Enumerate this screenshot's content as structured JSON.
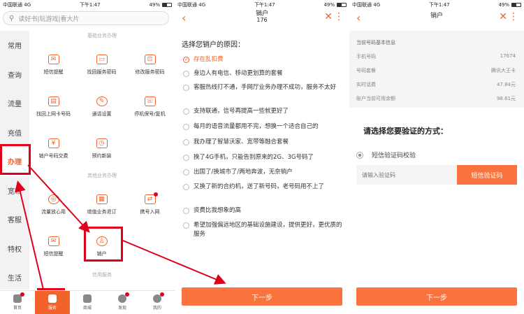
{
  "accent_color": "#f2632b",
  "highlight_color": "#e0001b",
  "status_bar": {
    "carrier": "中国联通",
    "network": "4G",
    "time": "下午1:47",
    "battery": "49%"
  },
  "panel1": {
    "search_placeholder": "读好书|玩游戏|看大片",
    "sidebar": [
      "常用",
      "查询",
      "流量",
      "充值",
      "办理",
      "宽带",
      "客服",
      "特权",
      "生活"
    ],
    "section_basic": "基础业务办理",
    "basic_items": [
      "短信提醒",
      "找回服务密码",
      "修改服务密码",
      "找回上网卡号码",
      "通话设置",
      "停机保号/复机",
      "销户号码交费",
      "预约新装"
    ],
    "section_other": "其他业务办理",
    "other_items": [
      "流量放心用",
      "增值业务退订",
      "携号入网",
      "短信提醒",
      "销户"
    ],
    "section_credit": "信用服务",
    "tabs": [
      "首页",
      "服务",
      "商城",
      "发现",
      "我的"
    ]
  },
  "panel2": {
    "title": "销户",
    "subtitle": "176",
    "question": "选择您销户的原因：",
    "reasons": [
      "存在乱扣费",
      "身边人有电信、移动更划算的套餐",
      "客服热线打不通，手网厅业务办理不成功，服务不太好",
      "支持联通，信号再提高一些就更好了",
      "每月的语音流量都用不完，想换一个适合自己的",
      "我办理了智慧沃家、宽带等融合套餐",
      "换了4G手机，只能告别原来的2G、3G号码了",
      "出国了/换城市了/两地奔波，无奈销户",
      "又换了新的合约机，送了新号码，老号码用不上了",
      "资费比我想象的高",
      "希望加强偏远地区的基础设施建设，提供更好，更优质的服务"
    ],
    "next_button": "下一步"
  },
  "panel3": {
    "title": "销户",
    "info_title": "当前号码基本信息",
    "info_rows": [
      {
        "label": "手机号码",
        "value": "17674"
      },
      {
        "label": "号码套餐",
        "value": "腾讯大王卡"
      },
      {
        "label": "实时话费",
        "value": "47.84元"
      },
      {
        "label": "账户当前可用余额",
        "value": "98.61元"
      }
    ],
    "verify_title": "请选择您要验证的方式：",
    "verify_option": "短信验证码校验",
    "code_placeholder": "请输入验证码",
    "code_button": "短信验证码",
    "next_button": "下一步"
  }
}
